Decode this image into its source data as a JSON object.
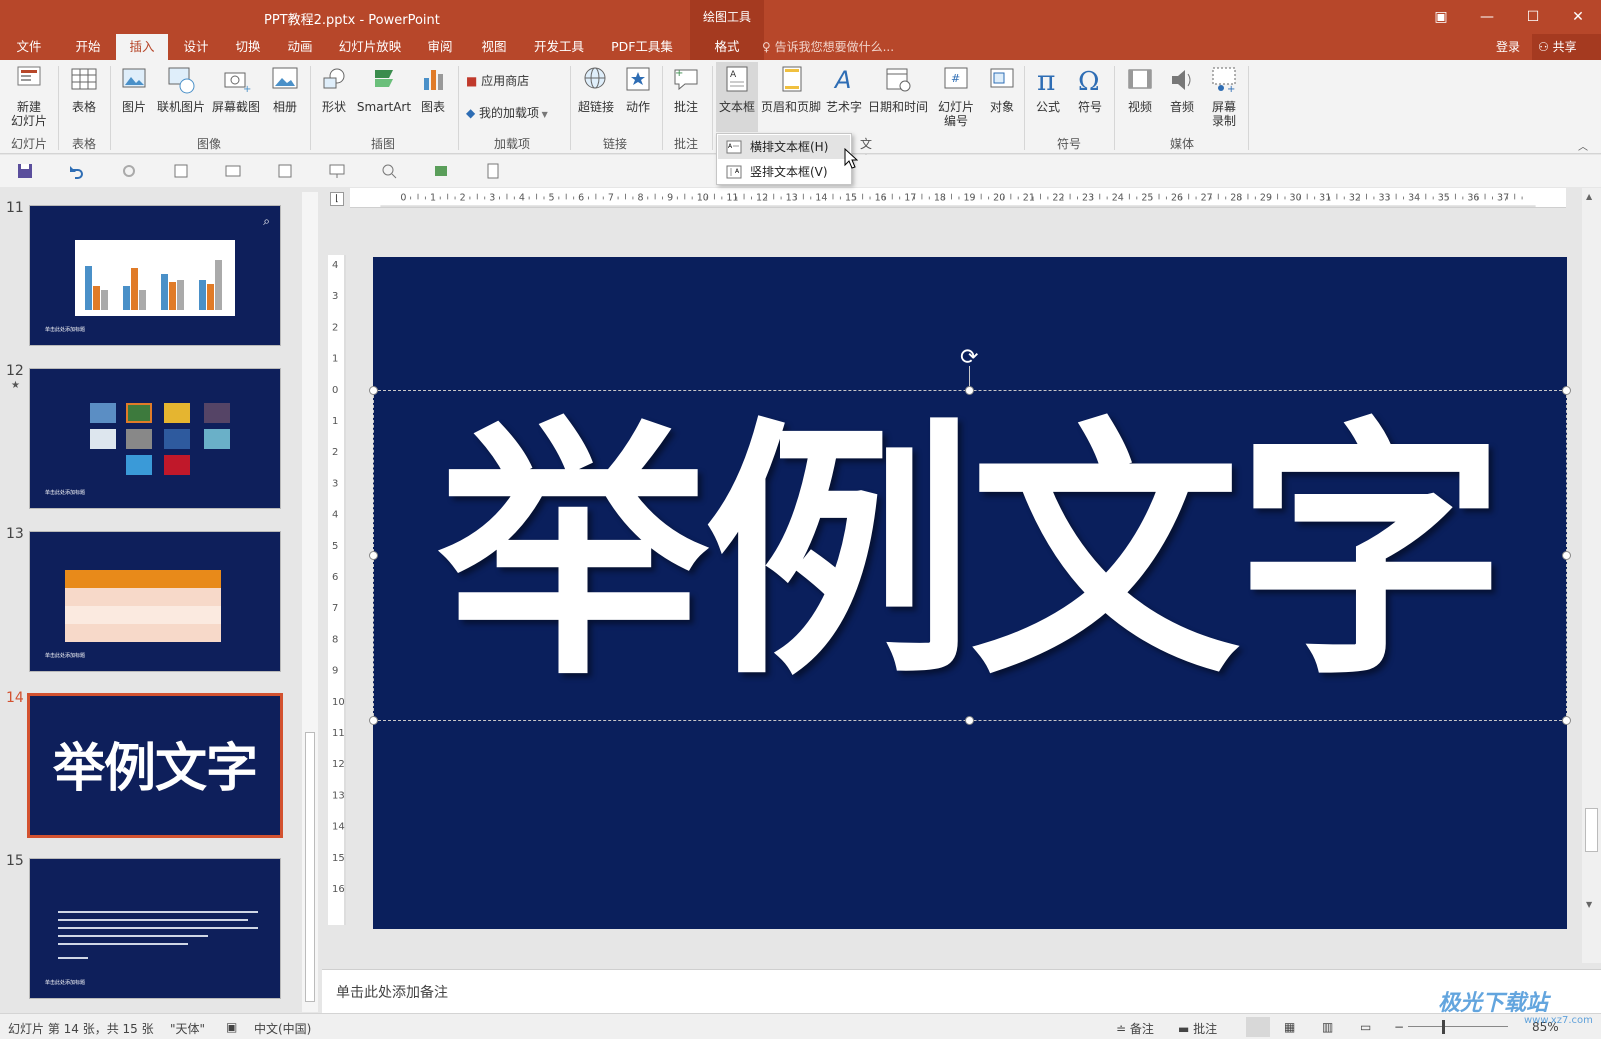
{
  "window": {
    "title": "PPT教程2.pptx - PowerPoint",
    "context_title": "绘图工具"
  },
  "tabs": [
    "文件",
    "开始",
    "插入",
    "设计",
    "切换",
    "动画",
    "幻灯片放映",
    "审阅",
    "视图",
    "开发工具",
    "PDF工具集",
    "格式"
  ],
  "active_tab": "插入",
  "tell_me": "告诉我您想要做什么...",
  "account": {
    "login": "登录",
    "share": "共享"
  },
  "ribbon": {
    "slides": {
      "new_slide": "新建\n幻灯片",
      "group": "幻灯片"
    },
    "tables": {
      "table": "表格",
      "group": "表格"
    },
    "images": {
      "picture": "图片",
      "online_picture": "联机图片",
      "screenshot": "屏幕截图",
      "album": "相册",
      "group": "图像"
    },
    "illustrations": {
      "shapes": "形状",
      "smartart": "SmartArt",
      "chart": "图表",
      "group": "插图"
    },
    "addins": {
      "store": "应用商店",
      "my_addins": "我的加载项",
      "group": "加载项"
    },
    "links": {
      "hyperlink": "超链接",
      "action": "动作",
      "group": "链接"
    },
    "comments": {
      "comment": "批注",
      "group": "批注"
    },
    "text": {
      "textbox": "文本框",
      "header_footer": "页眉和页脚",
      "wordart": "艺术字",
      "datetime": "日期和时间",
      "slide_number": "幻灯片\n编号",
      "object": "对象",
      "group": "文本"
    },
    "symbols": {
      "equation": "公式",
      "symbol": "符号",
      "group": "符号"
    },
    "media": {
      "video": "视频",
      "audio": "音频",
      "screen_recording": "屏幕\n录制",
      "group": "媒体"
    }
  },
  "dropdown": [
    "横排文本框(H)",
    "竖排文本框(V)"
  ],
  "slides": [
    {
      "num": "11",
      "caption": "单击此处添加标题"
    },
    {
      "num": "12",
      "caption": "单击此处添加标题",
      "star": "★"
    },
    {
      "num": "13",
      "caption": "单击此处添加标题"
    },
    {
      "num": "14",
      "text": "举例文字"
    },
    {
      "num": "15",
      "caption": "单击此处添加标题"
    }
  ],
  "slide_main_text": "举例文字",
  "notes_placeholder": "单击此处添加备注",
  "status": {
    "slide_info": "幻灯片 第 14 张，共 15 张",
    "theme": "\"天体\"",
    "language": "中文(中国)",
    "notes": "备注",
    "comments": "批注",
    "zoom": "85%"
  },
  "watermark": {
    "text": "极光下载站",
    "url": "www.xz7.com"
  },
  "colors": {
    "brand": "#b7472a",
    "slide_bg": "#0a1f5c",
    "selected_border": "#d35230"
  }
}
